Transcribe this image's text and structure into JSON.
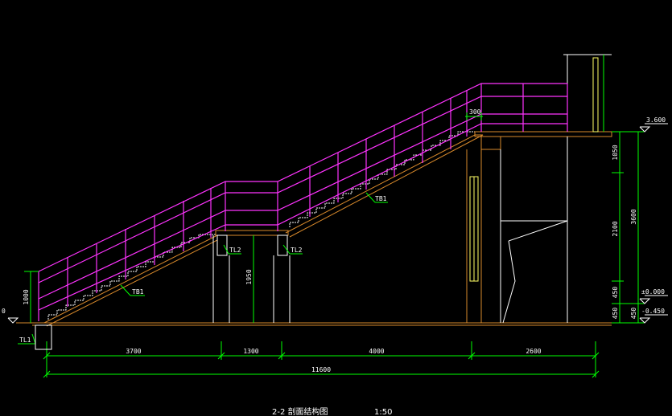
{
  "drawing": {
    "title": "2-2 剖面结构图",
    "scale": "1:50"
  },
  "dimensions": {
    "bottom_segments": [
      "3700",
      "1300",
      "4000",
      "2600"
    ],
    "bottom_total": "11600",
    "right_small": [
      "1050",
      "2100",
      "450",
      "450"
    ],
    "right_total": "3600",
    "column_height": "1950",
    "left_rail_height": "1000",
    "top_landing": "300"
  },
  "labels": {
    "elev_top": "3.600",
    "elev_zero": "±0.000",
    "elev_low": "-0.450",
    "elev_left": "0",
    "tb1_lower": "TB1",
    "tb1_upper": "TB1",
    "tl2_left": "TL2",
    "tl2_right": "TL2",
    "tl1": "TL1"
  },
  "colors": {
    "background": "#000000",
    "dimension": "#00ff00",
    "railing": "#ff33ff",
    "structure": "#ffff66",
    "concrete": "#d98a2b",
    "text": "#ffffff"
  }
}
